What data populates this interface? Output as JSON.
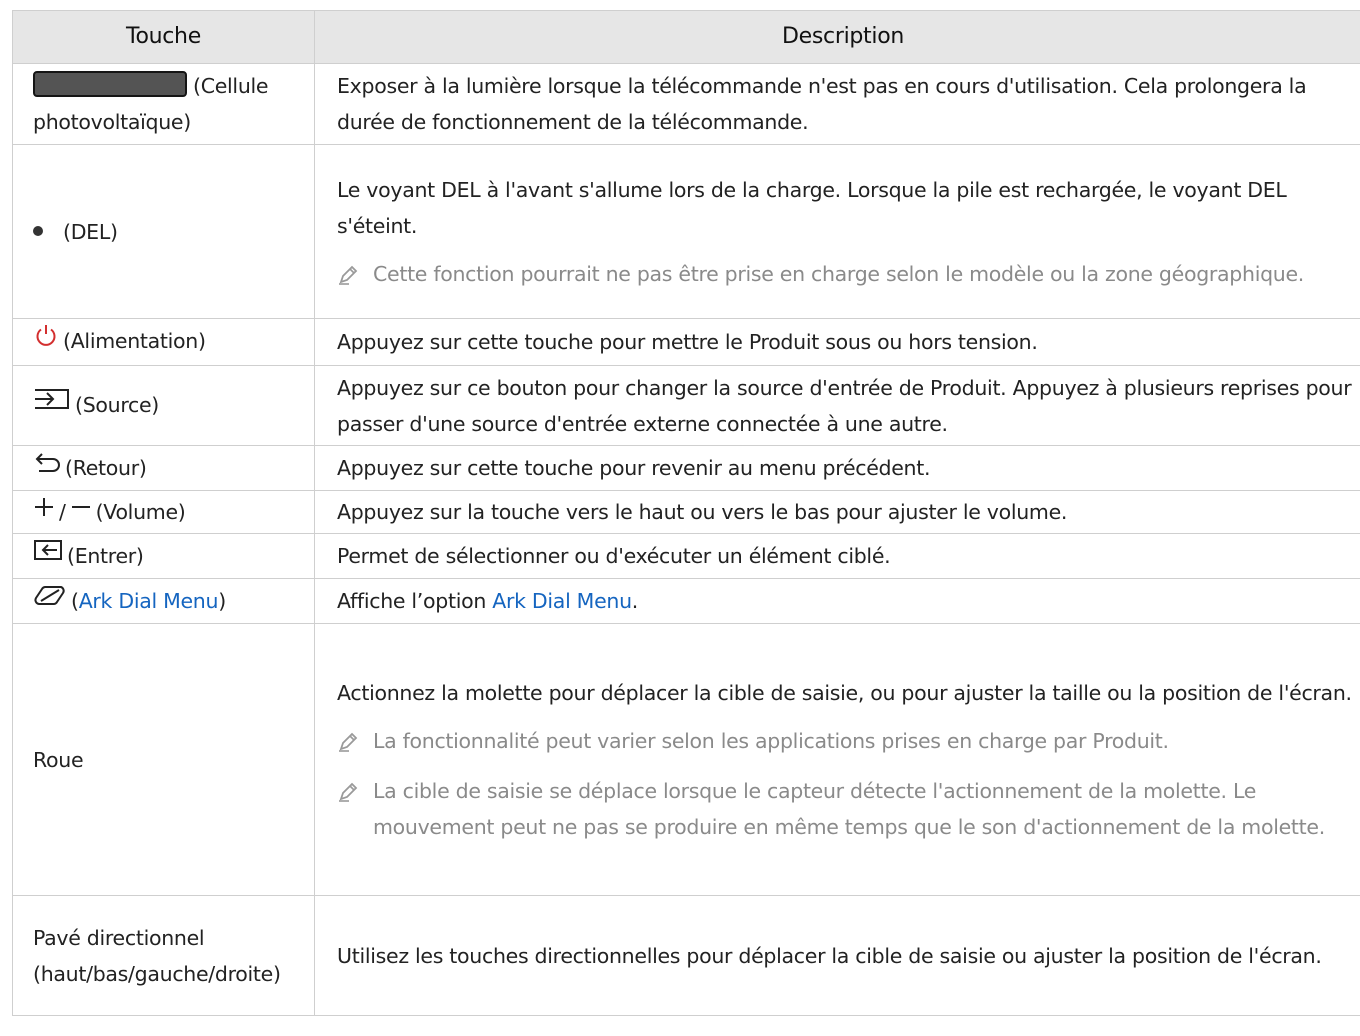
{
  "table": {
    "headers": {
      "key": "Touche",
      "desc": "Description"
    },
    "rows": {
      "solar": {
        "key": "(Cellule photovoltaïque)",
        "desc": "Exposer à la lumière lorsque la télécommande n'est pas en cours d'utilisation. Cela prolongera la durée de fonctionnement de la télécommande."
      },
      "led": {
        "key": "(DEL)",
        "desc": "Le voyant DEL à l'avant s'allume lors de la charge. Lorsque la pile est rechargée, le voyant DEL s'éteint.",
        "note": "Cette fonction pourrait ne pas être prise en charge selon le modèle ou la zone géographique."
      },
      "power": {
        "key": "(Alimentation)",
        "desc": "Appuyez sur cette touche pour mettre le Produit sous ou hors tension."
      },
      "source": {
        "key": "(Source)",
        "desc": "Appuyez sur ce bouton pour changer la source d'entrée de Produit. Appuyez à plusieurs reprises pour passer d'une source d'entrée externe connectée à une autre."
      },
      "back": {
        "key": "(Retour)",
        "desc": "Appuyez sur cette touche pour revenir au menu précédent."
      },
      "volume": {
        "key_sep": "/",
        "key": "(Volume)",
        "desc": "Appuyez sur la touche vers le haut ou vers le bas pour ajuster le volume."
      },
      "enter": {
        "key": "(Entrer)",
        "desc": "Permet de sélectionner ou d'exécuter un élément ciblé."
      },
      "ark": {
        "key_open": "(",
        "key_link": "Ark Dial Menu",
        "key_close": ")",
        "desc_pre": "Affiche l’option ",
        "desc_link": "Ark Dial Menu",
        "desc_post": "."
      },
      "wheel": {
        "key": "Roue",
        "desc": "Actionnez la molette pour déplacer la cible de saisie, ou pour ajuster la taille ou la position de l'écran.",
        "note1": "La fonctionnalité peut varier selon les applications prises en charge par Produit.",
        "note2": "La cible de saisie se déplace lorsque le capteur détecte l'actionnement de la molette. Le mouvement peut ne pas se produire en même temps que le son d'actionnement de la molette."
      },
      "dpad": {
        "key": "Pavé directionnel (haut/bas/gauche/droite)",
        "desc": "Utilisez les touches directionnelles pour déplacer la cible de saisie ou ajuster la position de l'écran."
      }
    }
  },
  "icons": {
    "led": "dot-icon",
    "power": "power-icon",
    "source": "source-icon",
    "back": "return-icon",
    "volume": "plus-minus-icon",
    "enter": "enter-icon",
    "ark": "ark-dial-icon",
    "note": "pencil-note-icon"
  },
  "colors": {
    "header_bg": "#e6e6e6",
    "border": "#cfcfcf",
    "link": "#1565c0",
    "power_icon": "#d32f2f",
    "note_text": "#8a8a8a"
  }
}
